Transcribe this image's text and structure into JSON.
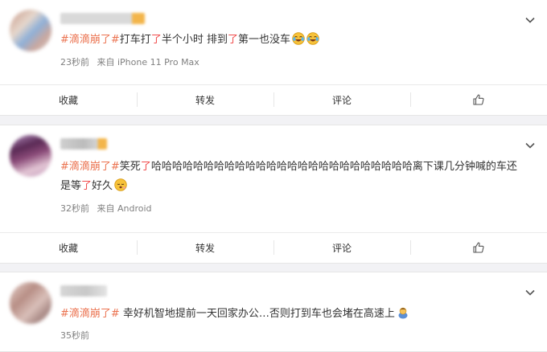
{
  "posts": [
    {
      "tag": "#滴滴崩了#",
      "segments": [
        {
          "t": "打车打",
          "red": false
        },
        {
          "t": "了",
          "red": true
        },
        {
          "t": "半个小时 排到",
          "red": false
        },
        {
          "t": "了",
          "red": true
        },
        {
          "t": "第一也没车",
          "red": false
        }
      ],
      "emoji": [
        "laugh-cry-icon",
        "laugh-cry-icon"
      ],
      "time": "23秒前",
      "source": "来自 iPhone 11 Pro Max"
    },
    {
      "tag": "#滴滴崩了#",
      "segments": [
        {
          "t": "笑死",
          "red": false
        },
        {
          "t": "了",
          "red": true
        },
        {
          "t": "哈哈哈哈哈哈哈哈哈哈哈哈哈哈哈哈哈哈哈哈哈哈哈哈哈离下课几分钟喊的车还是等",
          "red": false
        },
        {
          "t": "了",
          "red": true
        },
        {
          "t": "好久",
          "red": false
        }
      ],
      "emoji": [
        "sleepy-face-icon"
      ],
      "time": "32秒前",
      "source": "来自 Android"
    },
    {
      "tag": "#滴滴崩了#",
      "segments": [
        {
          "t": " 幸好机智地提前一天回家办公…否则打到车也会堵在高速上",
          "red": false
        }
      ],
      "emoji": [
        "bowing-person-icon"
      ],
      "time": "35秒前",
      "source": ""
    }
  ],
  "actions": {
    "favorite": "收藏",
    "repost": "转发",
    "comment": "评论"
  },
  "colors": {
    "tag": "#eb7350",
    "highlight": "#f04b4b",
    "meta": "#808080"
  }
}
